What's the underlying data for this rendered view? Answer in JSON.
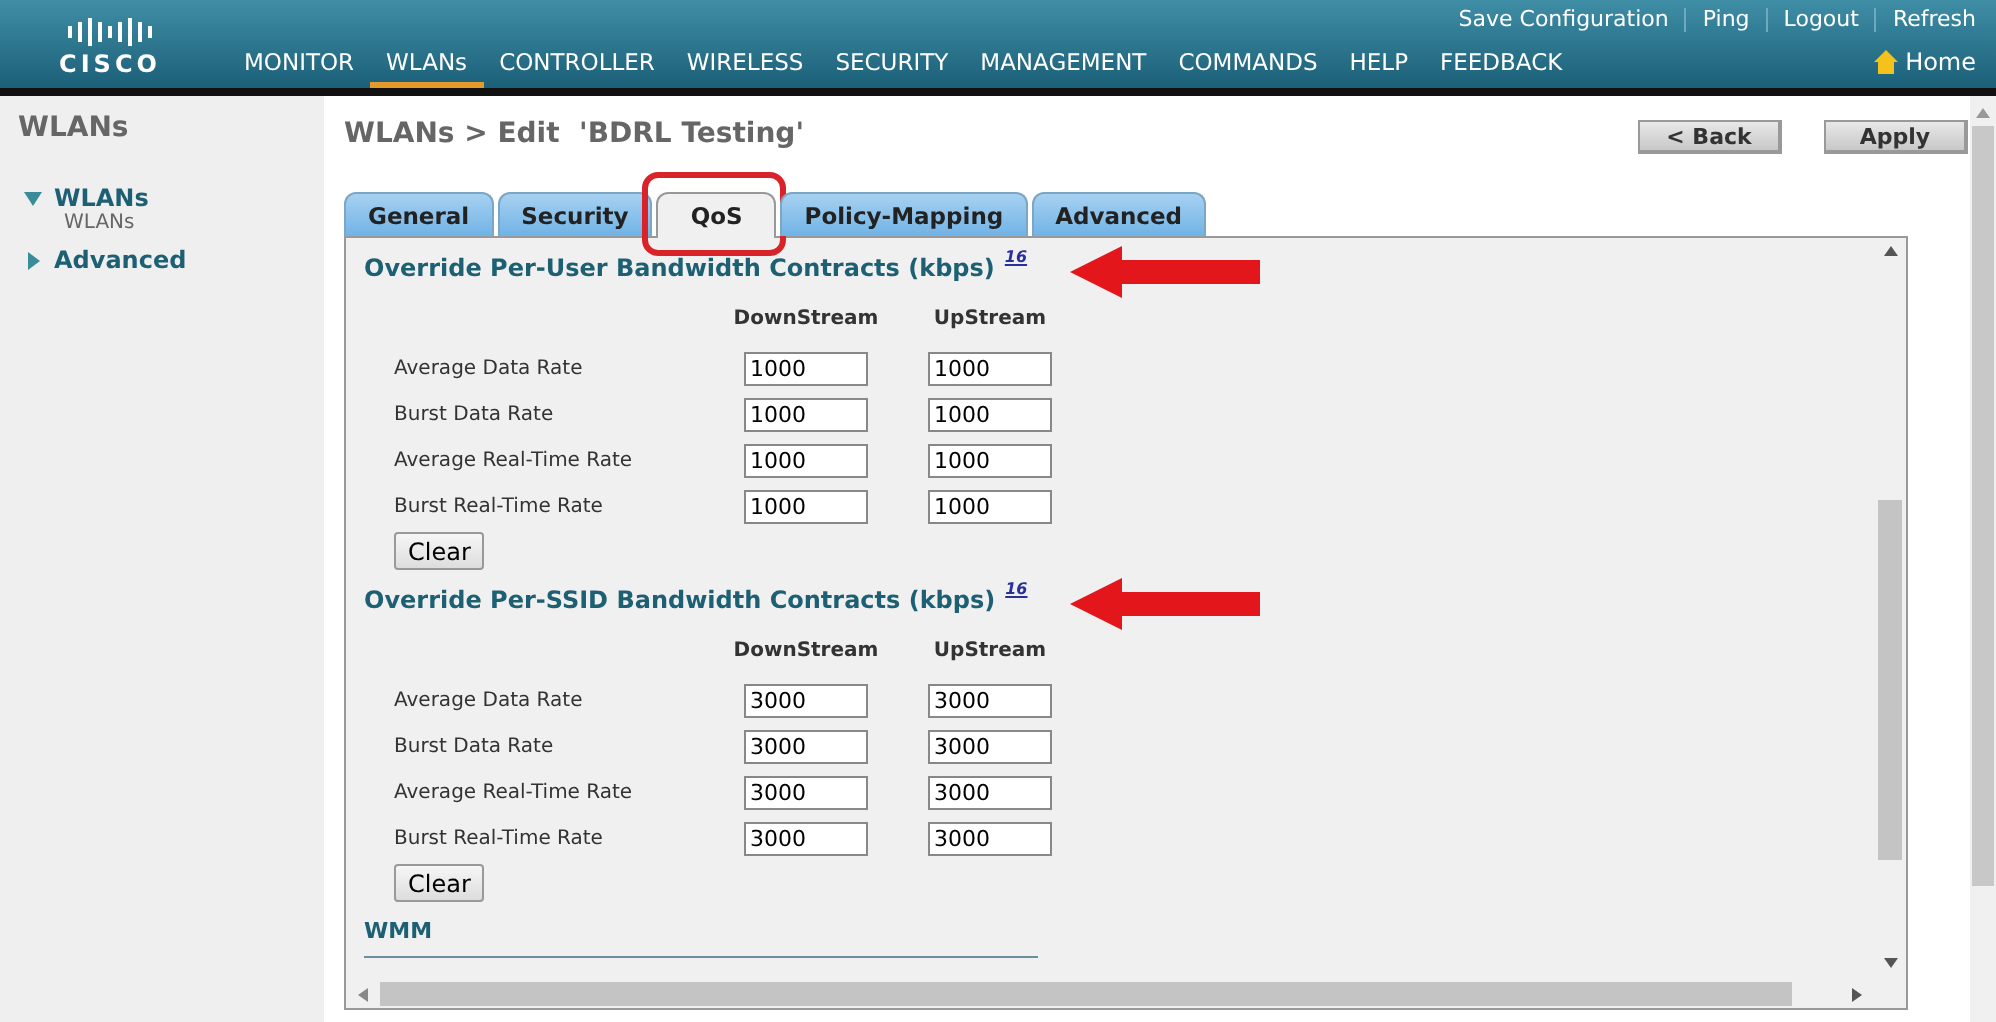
{
  "header": {
    "logo": "CISCO",
    "top_links": [
      "Save Configuration",
      "Ping",
      "Logout",
      "Refresh"
    ],
    "nav": [
      {
        "label": "MONITOR",
        "selected": false
      },
      {
        "label": "WLANs",
        "selected": true
      },
      {
        "label": "CONTROLLER",
        "selected": false
      },
      {
        "label": "WIRELESS",
        "selected": false
      },
      {
        "label": "SECURITY",
        "selected": false
      },
      {
        "label": "MANAGEMENT",
        "selected": false
      },
      {
        "label": "COMMANDS",
        "selected": false
      },
      {
        "label": "HELP",
        "selected": false
      },
      {
        "label": "FEEDBACK",
        "selected": false
      }
    ],
    "home": "Home"
  },
  "sidebar": {
    "title": "WLANs",
    "items": [
      {
        "label": "WLANs",
        "expanded": true,
        "children": [
          {
            "label": "WLANs"
          }
        ]
      },
      {
        "label": "Advanced",
        "expanded": false
      }
    ]
  },
  "page": {
    "breadcrumb": "WLANs > Edit  'BDRL Testing'",
    "buttons": [
      "< Back",
      "Apply"
    ]
  },
  "tabs": [
    {
      "label": "General",
      "selected": false
    },
    {
      "label": "Security",
      "selected": false
    },
    {
      "label": "QoS",
      "selected": true
    },
    {
      "label": "Policy-Mapping",
      "selected": false
    },
    {
      "label": "Advanced",
      "selected": false
    }
  ],
  "sections": [
    {
      "title": "Override Per-User Bandwidth Contracts (kbps)",
      "footnote": "16",
      "columns": [
        "DownStream",
        "UpStream"
      ],
      "rows": [
        {
          "label": "Average Data Rate",
          "downstream": "1000",
          "upstream": "1000"
        },
        {
          "label": "Burst Data Rate",
          "downstream": "1000",
          "upstream": "1000"
        },
        {
          "label": "Average Real-Time Rate",
          "downstream": "1000",
          "upstream": "1000"
        },
        {
          "label": "Burst Real-Time Rate",
          "downstream": "1000",
          "upstream": "1000"
        }
      ],
      "button": "Clear"
    },
    {
      "title": "Override Per-SSID Bandwidth Contracts (kbps)",
      "footnote": "16",
      "columns": [
        "DownStream",
        "UpStream"
      ],
      "rows": [
        {
          "label": "Average Data Rate",
          "downstream": "3000",
          "upstream": "3000"
        },
        {
          "label": "Burst Data Rate",
          "downstream": "3000",
          "upstream": "3000"
        },
        {
          "label": "Average Real-Time Rate",
          "downstream": "3000",
          "upstream": "3000"
        },
        {
          "label": "Burst Real-Time Rate",
          "downstream": "3000",
          "upstream": "3000"
        }
      ],
      "button": "Clear"
    }
  ],
  "wmm": {
    "title": "WMM"
  }
}
